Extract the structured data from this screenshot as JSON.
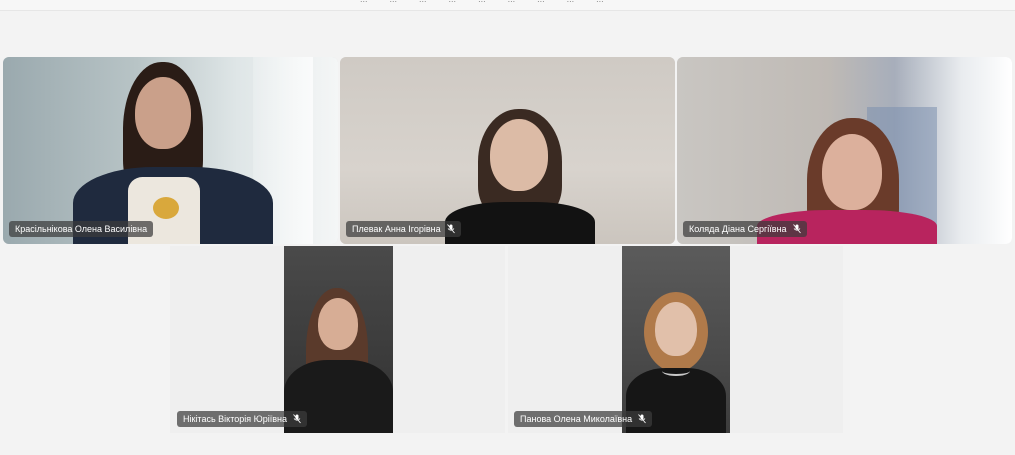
{
  "top_bar": {
    "menu_items": [
      "...",
      "...",
      "...",
      "...",
      "...",
      "...",
      "...",
      "...",
      "..."
    ]
  },
  "participants": [
    {
      "name": "Красільнікова Олена Василівна",
      "muted": false
    },
    {
      "name": "Плевак Анна Ігорівна",
      "muted": true
    },
    {
      "name": "Коляда Діана Сергіївна",
      "muted": true
    },
    {
      "name": "Нікітась Вікторія Юріївна",
      "muted": true
    },
    {
      "name": "Панова Олена Миколаївна",
      "muted": true
    }
  ],
  "icons": {
    "mute": "mic-off-icon"
  },
  "colors": {
    "name_tag_bg": "#3c3c3c",
    "name_tag_text": "#ffffff",
    "stage_bg": "#f3f3f3"
  }
}
